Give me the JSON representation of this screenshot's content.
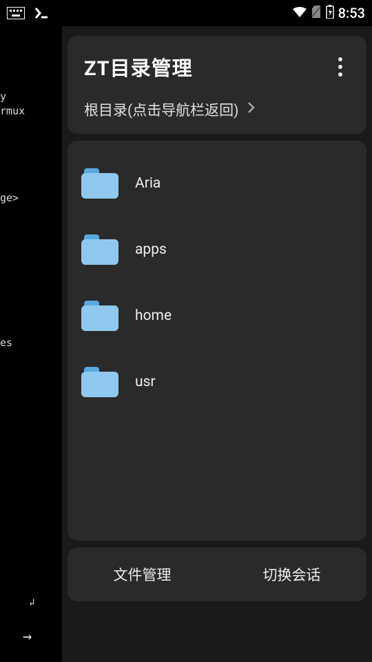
{
  "status_bar": {
    "time": "8:53"
  },
  "terminal": {
    "lines": "\ny\nrmux\n\n\n\n\n\nge>\n\n\n\n\n\n\n\n\n\nes"
  },
  "header": {
    "title": "ZT目录管理",
    "breadcrumb": "根目录(点击导航栏返回)"
  },
  "folders": [
    {
      "name": "Aria"
    },
    {
      "name": "apps"
    },
    {
      "name": "home"
    },
    {
      "name": "usr"
    }
  ],
  "bottom": {
    "file_manage": "文件管理",
    "switch_session": "切换会话"
  }
}
